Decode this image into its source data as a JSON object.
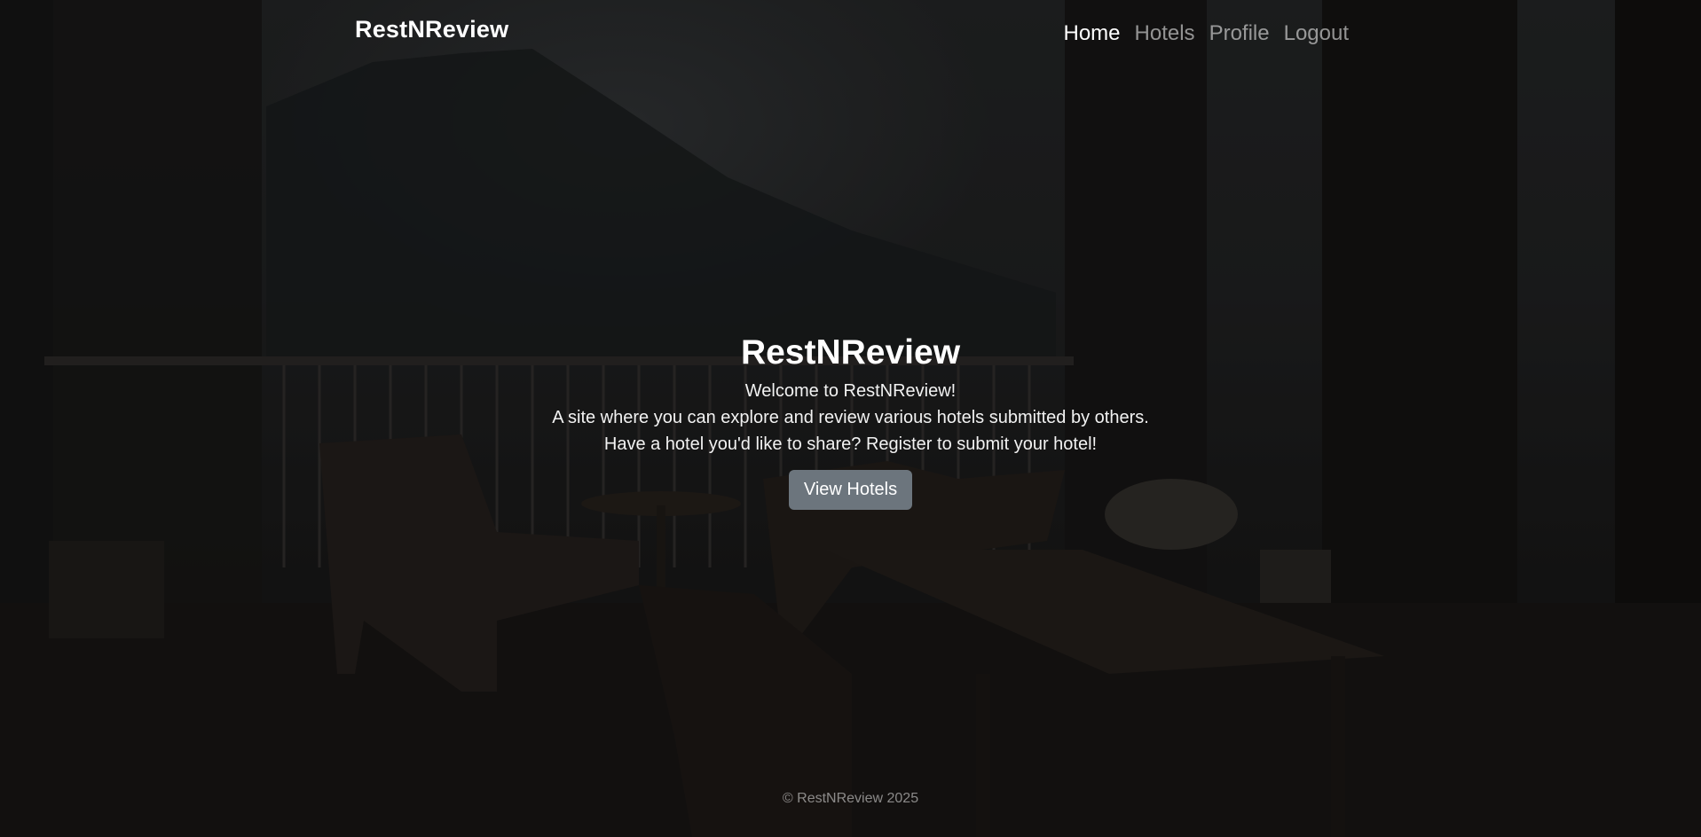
{
  "navbar": {
    "brand": "RestNReview",
    "links": [
      {
        "label": "Home",
        "active": true
      },
      {
        "label": "Hotels",
        "active": false
      },
      {
        "label": "Profile",
        "active": false
      },
      {
        "label": "Logout",
        "active": false
      }
    ]
  },
  "hero": {
    "title": "RestNReview",
    "lines": [
      "Welcome to RestNReview!",
      "A site where you can explore and review various hotels submitted by others.",
      "Have a hotel you'd like to share? Register to submit your hotel!"
    ],
    "button_label": "View Hotels"
  },
  "footer": {
    "text": "© RestNReview 2025"
  },
  "colors": {
    "button_bg": "#6c757d",
    "text_primary": "#ffffff",
    "nav_inactive": "rgba(255,255,255,0.55)"
  }
}
